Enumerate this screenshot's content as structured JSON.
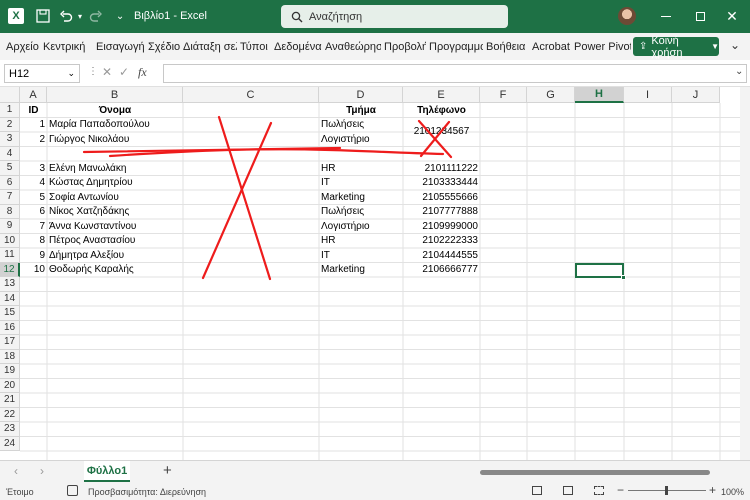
{
  "titlebar": {
    "title": "Βιβλίο1 - Excel",
    "search": "Αναζήτηση"
  },
  "menu": [
    "Αρχείο",
    "Κεντρική",
    "Εισαγωγή",
    "Σχέδιο",
    "Διάταξη σελ",
    "Τύποι",
    "Δεδομένα",
    "Αναθεώρησ",
    "Προβολή",
    "Προγραμμα",
    "Βοήθεια",
    "Acrobat",
    "Power Pivot"
  ],
  "share": "Κοινή χρήση",
  "formula": {
    "namebox": "H12",
    "fx": "fx"
  },
  "columns": [
    "A",
    "B",
    "C",
    "D",
    "E",
    "F",
    "G",
    "H",
    "I",
    "J"
  ],
  "rows": [
    "1",
    "2",
    "3",
    "4",
    "5",
    "6",
    "7",
    "8",
    "9",
    "10",
    "11",
    "12",
    "13",
    "14",
    "15",
    "16",
    "17",
    "18",
    "19",
    "20",
    "21",
    "22",
    "23",
    "24"
  ],
  "cells": [
    {
      "text": "ID",
      "col": "A",
      "row": 1,
      "bold": true,
      "align": "center"
    },
    {
      "text": "Όνομα",
      "col": "B",
      "row": 1,
      "bold": true,
      "align": "center"
    },
    {
      "text": "Τμήμα",
      "col": "D",
      "row": 1,
      "bold": true,
      "align": "center"
    },
    {
      "text": "Τηλέφωνο",
      "col": "E",
      "row": 1,
      "bold": true,
      "align": "center"
    },
    {
      "text": "1",
      "col": "A",
      "row": 2,
      "align": "right"
    },
    {
      "text": "Μαρία Παπαδοπούλου",
      "col": "B",
      "row": 2
    },
    {
      "text": "Πωλήσεις",
      "col": "D",
      "row": 2
    },
    {
      "text": "2",
      "col": "A",
      "row": 3,
      "align": "right"
    },
    {
      "text": "Γιώργος Νικολάου",
      "col": "B",
      "row": 3
    },
    {
      "text": "Λογιστήριο",
      "col": "D",
      "row": 3
    },
    {
      "text": "2101234567",
      "col": "E",
      "row": 2.5,
      "align": "center"
    },
    {
      "text": "3",
      "col": "A",
      "row": 5,
      "align": "right"
    },
    {
      "text": "Ελένη Μανωλάκη",
      "col": "B",
      "row": 5
    },
    {
      "text": "HR",
      "col": "D",
      "row": 5
    },
    {
      "text": "2101111222",
      "col": "E",
      "row": 5,
      "align": "right"
    },
    {
      "text": "4",
      "col": "A",
      "row": 6,
      "align": "right"
    },
    {
      "text": "Κώστας Δημητρίου",
      "col": "B",
      "row": 6
    },
    {
      "text": "IT",
      "col": "D",
      "row": 6
    },
    {
      "text": "2103333444",
      "col": "E",
      "row": 6,
      "align": "right"
    },
    {
      "text": "5",
      "col": "A",
      "row": 7,
      "align": "right"
    },
    {
      "text": "Σοφία Αντωνίου",
      "col": "B",
      "row": 7
    },
    {
      "text": "Marketing",
      "col": "D",
      "row": 7
    },
    {
      "text": "2105555666",
      "col": "E",
      "row": 7,
      "align": "right"
    },
    {
      "text": "6",
      "col": "A",
      "row": 8,
      "align": "right"
    },
    {
      "text": "Νίκος Χατζηδάκης",
      "col": "B",
      "row": 8
    },
    {
      "text": "Πωλήσεις",
      "col": "D",
      "row": 8
    },
    {
      "text": "2107777888",
      "col": "E",
      "row": 8,
      "align": "right"
    },
    {
      "text": "7",
      "col": "A",
      "row": 9,
      "align": "right"
    },
    {
      "text": "Άννα Κωνσταντίνου",
      "col": "B",
      "row": 9
    },
    {
      "text": "Λογιστήριο",
      "col": "D",
      "row": 9
    },
    {
      "text": "2109999000",
      "col": "E",
      "row": 9,
      "align": "right"
    },
    {
      "text": "8",
      "col": "A",
      "row": 10,
      "align": "right"
    },
    {
      "text": "Πέτρος Αναστασίου",
      "col": "B",
      "row": 10
    },
    {
      "text": "HR",
      "col": "D",
      "row": 10
    },
    {
      "text": "2102222333",
      "col": "E",
      "row": 10,
      "align": "right"
    },
    {
      "text": "9",
      "col": "A",
      "row": 11,
      "align": "right"
    },
    {
      "text": "Δήμητρα Αλεξίου",
      "col": "B",
      "row": 11
    },
    {
      "text": "IT",
      "col": "D",
      "row": 11
    },
    {
      "text": "2104444555",
      "col": "E",
      "row": 11,
      "align": "right"
    },
    {
      "text": "10",
      "col": "A",
      "row": 12,
      "align": "right"
    },
    {
      "text": "Θοδωρής Καραλής",
      "col": "B",
      "row": 12
    },
    {
      "text": "Marketing",
      "col": "D",
      "row": 12
    },
    {
      "text": "2106666777",
      "col": "E",
      "row": 12,
      "align": "right"
    }
  ],
  "selected_cell": "H12",
  "sheet_tab": "Φύλλο1",
  "status": {
    "ready": "Έτοιμο",
    "accessibility": "Προσβασιμότητα: Διερεύνηση",
    "zoom": "100%"
  },
  "colors": {
    "accent": "#1e7145",
    "ink": "#ee1c1c"
  }
}
